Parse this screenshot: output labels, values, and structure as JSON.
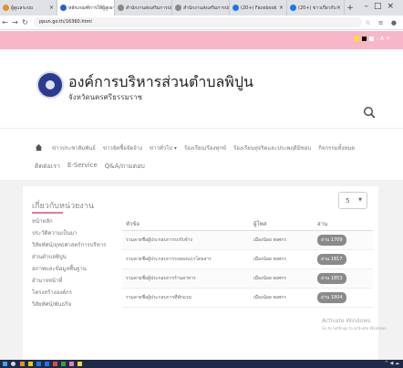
{
  "browser": {
    "tabs": [
      {
        "label": "ผู้ดูแลระบบ",
        "active": false,
        "color": "#e0922b"
      },
      {
        "label": "หลักเกณฑ์การให้ผู้สูงอายุ",
        "active": true,
        "color": "#2a5bd7"
      },
      {
        "label": "สำนักงานส่งเสริมการปกครอง",
        "active": false,
        "color": "#888888"
      },
      {
        "label": "สำนักงานส่งเสริมการปกครอง",
        "active": false,
        "color": "#888888"
      },
      {
        "label": "(20+) Facebook",
        "active": false,
        "color": "#1877f2"
      },
      {
        "label": "(20+) ข่าวเกี่ยวกับ",
        "active": false,
        "color": "#1877f2"
      }
    ],
    "url": "ppun.go.th/16360.html"
  },
  "site": {
    "title": "องค์การบริหารส่วนตำบลพิปูน",
    "subtitle": "จังหวัดนครศรีธรรมราช"
  },
  "menu": {
    "row1": [
      "ข่าวประชาสัมพันธ์",
      "ข่าวจัดซื้อจัดจ้าง",
      "ข่าวทั่วไป ▾",
      "ร้องเรียน/ร้องทุกข์",
      "ร้องเรียนทุจริตและประพฤติมิชอบ",
      "กิจกรรมทั้งหมด"
    ],
    "row2": [
      "ติดต่อเรา",
      "E-Service",
      "Q&A/ถามตอบ"
    ]
  },
  "card": {
    "title": "เกี่ยวกับหน่วยงาน",
    "per_page": "5"
  },
  "sidebar": [
    "หน้าหลัก",
    "ประวัติความเป็นมา",
    "วิสัยทัศน์/ยุทธศาสตร์การบริหาร",
    "ส่วนตำบลพิปูน",
    "สภาพและข้อมูลพื้นฐาน",
    "อำนาจหน้าที่",
    "โครงสร้างองค์กร",
    "วิสัยทัศน์/พันธกิจ"
  ],
  "table": {
    "headers": [
      "หัวข้อ",
      "ผู้โพส",
      "อ่าน"
    ],
    "rows": [
      {
        "title": "รวมลายชื่อผู้ประกอบการรถรับจ้าง",
        "author": "เมืองน้อย พงศกร",
        "views": "อ่าน 1709"
      },
      {
        "title": "รวมลายชื่อผู้ประกอบการรถสองแถวโดยสาร",
        "author": "เมืองน้อย พงศกร",
        "views": "อ่าน 1817"
      },
      {
        "title": "รวมลายชื่อผู้ประกอบการร้านอาหาร",
        "author": "เมืองน้อย พงศกร",
        "views": "อ่าน 1853"
      },
      {
        "title": "รวมลายชื่อผู้ประกอบการที่พักแรม",
        "author": "เมืองน้อย พงศกร",
        "views": "อ่าน 1804"
      }
    ]
  },
  "watermark": {
    "line1": "Activate Windows",
    "line2": "Go to Settings to activate Windows."
  }
}
